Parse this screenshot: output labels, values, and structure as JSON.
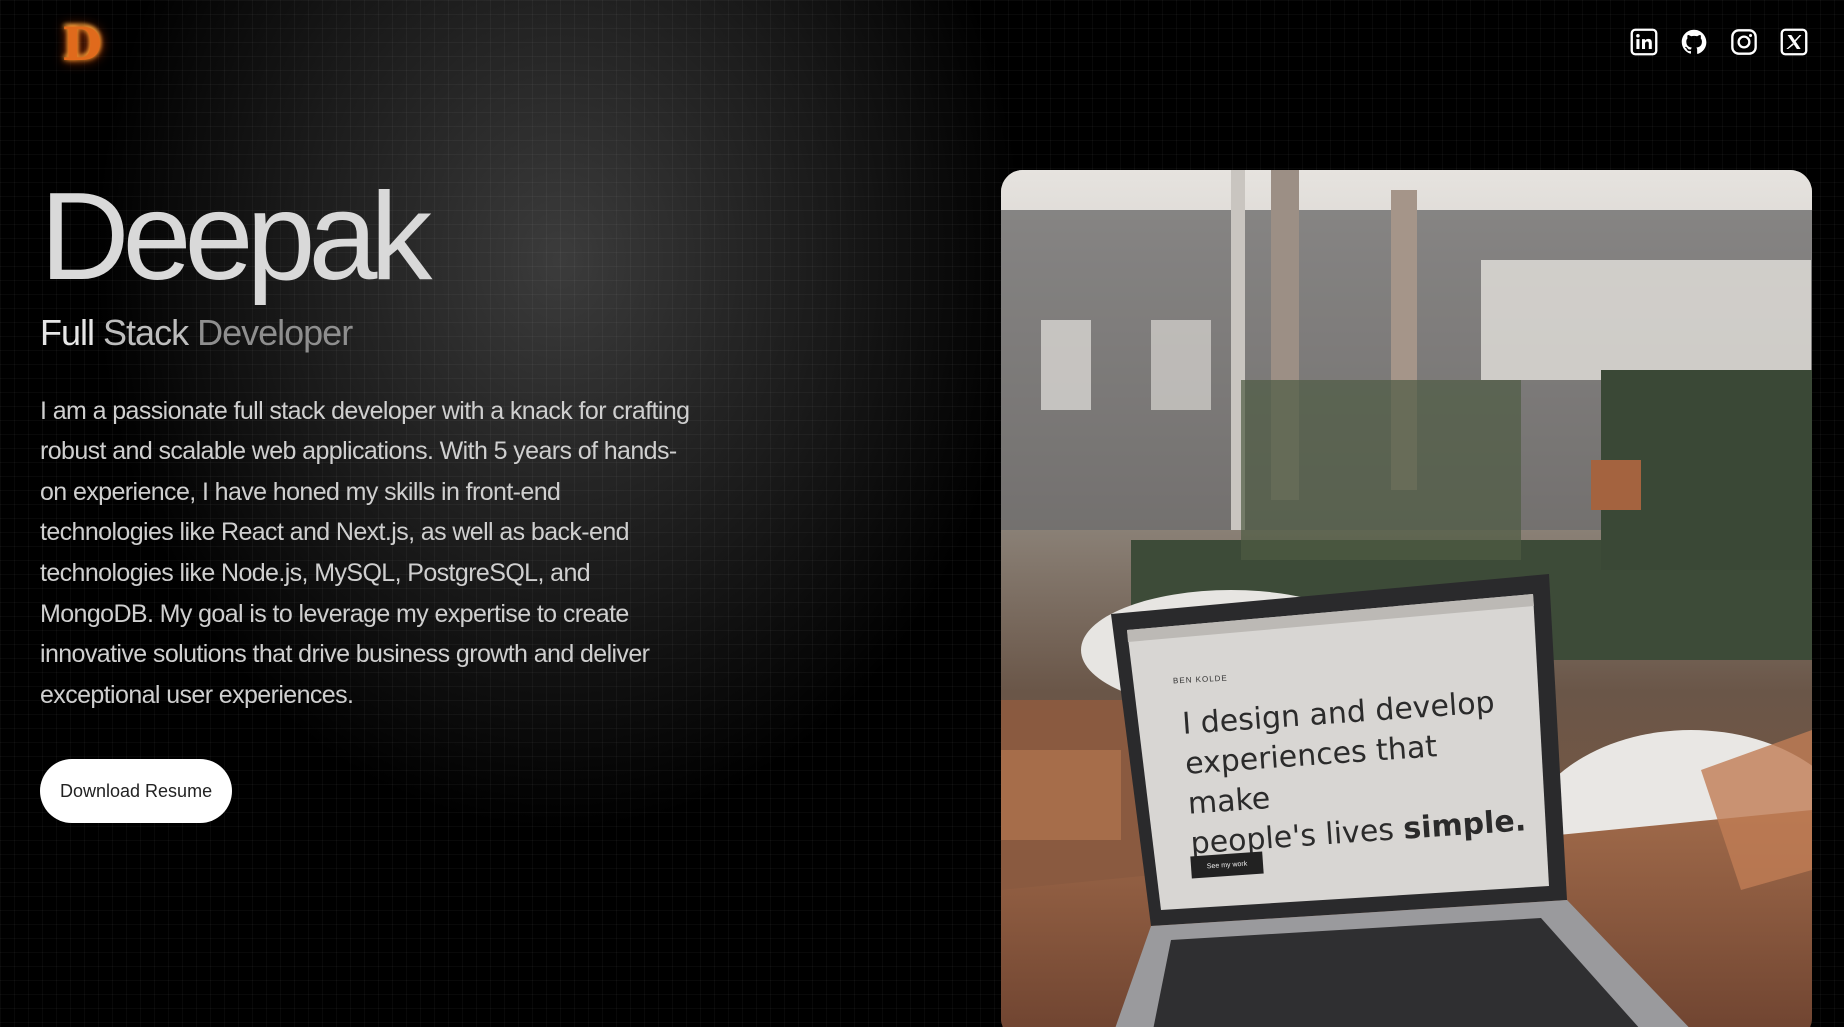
{
  "logo": {
    "letter": "D"
  },
  "socials": [
    {
      "name": "linkedin",
      "icon": "linkedin-icon"
    },
    {
      "name": "github",
      "icon": "github-icon"
    },
    {
      "name": "instagram",
      "icon": "instagram-icon"
    },
    {
      "name": "x",
      "icon": "x-icon"
    }
  ],
  "hero": {
    "name": "Deepak",
    "role": {
      "w1": "Full",
      "w2": "Stack",
      "w3": "Developer"
    },
    "bio": "I am a passionate full stack developer with a knack for crafting robust and scalable web applications. With 5 years of hands-on experience, I have honed my skills in front-end technologies like React and Next.js, as well as back-end technologies like Node.js, MySQL, PostgreSQL, and MongoDB. My goal is to leverage my expertise to create innovative solutions that drive business growth and deliver exceptional user experiences.",
    "button_label": "Download Resume"
  },
  "photo": {
    "screen_brand": "BEN KOLDE",
    "screen_line1": "I design and develop",
    "screen_line2": "experiences that make",
    "screen_line3_pre": "people's lives ",
    "screen_line3_bold": "simple.",
    "screen_button": "See my work"
  },
  "colors": {
    "background": "#000000",
    "button_bg": "#ffffff",
    "logo": "#e06a1c"
  }
}
